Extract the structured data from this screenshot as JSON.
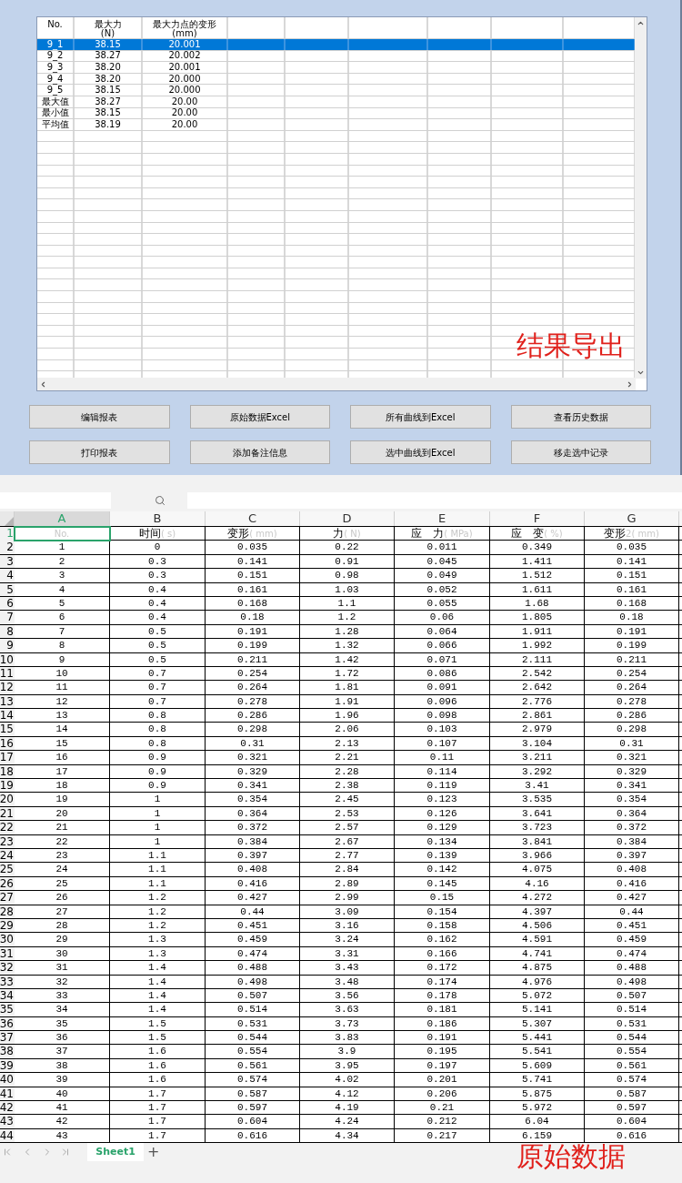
{
  "results_table": {
    "columns": [
      {
        "title": "No."
      },
      {
        "title": "最大力",
        "unit": "(N)"
      },
      {
        "title": "最大力点的变形",
        "unit": "(mm)"
      }
    ],
    "rows": [
      {
        "cells": [
          "9_1",
          "38.15",
          "20.001"
        ],
        "selected": true
      },
      {
        "cells": [
          "9_2",
          "38.27",
          "20.002"
        ],
        "selected": false
      },
      {
        "cells": [
          "9_3",
          "38.20",
          "20.001"
        ],
        "selected": false
      },
      {
        "cells": [
          "9_4",
          "38.20",
          "20.000"
        ],
        "selected": false
      },
      {
        "cells": [
          "9_5",
          "38.15",
          "20.000"
        ],
        "selected": false
      },
      {
        "cells": [
          "最大值",
          "38.27",
          "20.00"
        ],
        "selected": false
      },
      {
        "cells": [
          "最小值",
          "38.15",
          "20.00"
        ],
        "selected": false
      },
      {
        "cells": [
          "平均值",
          "38.19",
          "20.00"
        ],
        "selected": false
      }
    ],
    "overlay_label": "结果导出"
  },
  "buttons": [
    "编辑报表",
    "原始数据Excel",
    "所有曲线到Excel",
    "查看历史数据",
    "打印报表",
    "添加备注信息",
    "选中曲线到Excel",
    "移走选中记录"
  ],
  "sheet": {
    "columns": [
      {
        "letter": "A",
        "selected": true
      },
      {
        "letter": "B",
        "selected": false
      },
      {
        "letter": "C",
        "selected": false
      },
      {
        "letter": "D",
        "selected": false
      },
      {
        "letter": "E",
        "selected": false
      },
      {
        "letter": "F",
        "selected": false
      },
      {
        "letter": "G",
        "selected": false
      }
    ],
    "header_row": [
      {
        "unit": "No.",
        "selected": true
      },
      {
        "label": "时间",
        "unit": "( s)",
        "selected": false
      },
      {
        "label": "变形",
        "unit": "( mm)",
        "selected": false
      },
      {
        "label": "力",
        "unit": "( N)",
        "selected": false
      },
      {
        "label": "应　力",
        "unit": "( MPa)",
        "selected": false
      },
      {
        "label": "应　变",
        "unit": "( %)",
        "selected": false
      },
      {
        "label": "变形",
        "unit": "2( mm)",
        "selected": false
      }
    ],
    "row_headers": [
      {
        "label": "1",
        "selected": true
      },
      {
        "label": "2",
        "selected": false
      },
      {
        "label": "3",
        "selected": false
      },
      {
        "label": "4",
        "selected": false
      },
      {
        "label": "5",
        "selected": false
      },
      {
        "label": "6",
        "selected": false
      },
      {
        "label": "7",
        "selected": false
      },
      {
        "label": "8",
        "selected": false
      },
      {
        "label": "9",
        "selected": false
      },
      {
        "label": "10",
        "selected": false
      },
      {
        "label": "11",
        "selected": false
      },
      {
        "label": "12",
        "selected": false
      },
      {
        "label": "13",
        "selected": false
      },
      {
        "label": "14",
        "selected": false
      },
      {
        "label": "15",
        "selected": false
      },
      {
        "label": "16",
        "selected": false
      },
      {
        "label": "17",
        "selected": false
      },
      {
        "label": "18",
        "selected": false
      },
      {
        "label": "19",
        "selected": false
      },
      {
        "label": "20",
        "selected": false
      },
      {
        "label": "21",
        "selected": false
      },
      {
        "label": "22",
        "selected": false
      },
      {
        "label": "23",
        "selected": false
      },
      {
        "label": "24",
        "selected": false
      },
      {
        "label": "25",
        "selected": false
      },
      {
        "label": "26",
        "selected": false
      },
      {
        "label": "27",
        "selected": false
      },
      {
        "label": "28",
        "selected": false
      },
      {
        "label": "29",
        "selected": false
      },
      {
        "label": "30",
        "selected": false
      },
      {
        "label": "31",
        "selected": false
      },
      {
        "label": "32",
        "selected": false
      },
      {
        "label": "33",
        "selected": false
      },
      {
        "label": "34",
        "selected": false
      },
      {
        "label": "35",
        "selected": false
      },
      {
        "label": "36",
        "selected": false
      },
      {
        "label": "37",
        "selected": false
      },
      {
        "label": "38",
        "selected": false
      },
      {
        "label": "39",
        "selected": false
      },
      {
        "label": "40",
        "selected": false
      },
      {
        "label": "41",
        "selected": false
      },
      {
        "label": "42",
        "selected": false
      },
      {
        "label": "43",
        "selected": false
      },
      {
        "label": "44",
        "selected": false
      }
    ],
    "rows": [
      [
        "1",
        "0",
        "0.035",
        "0.22",
        "0.011",
        "0.349",
        "0.035"
      ],
      [
        "2",
        "0.3",
        "0.141",
        "0.91",
        "0.045",
        "1.411",
        "0.141"
      ],
      [
        "3",
        "0.3",
        "0.151",
        "0.98",
        "0.049",
        "1.512",
        "0.151"
      ],
      [
        "4",
        "0.4",
        "0.161",
        "1.03",
        "0.052",
        "1.611",
        "0.161"
      ],
      [
        "5",
        "0.4",
        "0.168",
        "1.1",
        "0.055",
        "1.68",
        "0.168"
      ],
      [
        "6",
        "0.4",
        "0.18",
        "1.2",
        "0.06",
        "1.805",
        "0.18"
      ],
      [
        "7",
        "0.5",
        "0.191",
        "1.28",
        "0.064",
        "1.911",
        "0.191"
      ],
      [
        "8",
        "0.5",
        "0.199",
        "1.32",
        "0.066",
        "1.992",
        "0.199"
      ],
      [
        "9",
        "0.5",
        "0.211",
        "1.42",
        "0.071",
        "2.111",
        "0.211"
      ],
      [
        "10",
        "0.7",
        "0.254",
        "1.72",
        "0.086",
        "2.542",
        "0.254"
      ],
      [
        "11",
        "0.7",
        "0.264",
        "1.81",
        "0.091",
        "2.642",
        "0.264"
      ],
      [
        "12",
        "0.7",
        "0.278",
        "1.91",
        "0.096",
        "2.776",
        "0.278"
      ],
      [
        "13",
        "0.8",
        "0.286",
        "1.96",
        "0.098",
        "2.861",
        "0.286"
      ],
      [
        "14",
        "0.8",
        "0.298",
        "2.06",
        "0.103",
        "2.979",
        "0.298"
      ],
      [
        "15",
        "0.8",
        "0.31",
        "2.13",
        "0.107",
        "3.104",
        "0.31"
      ],
      [
        "16",
        "0.9",
        "0.321",
        "2.21",
        "0.11",
        "3.211",
        "0.321"
      ],
      [
        "17",
        "0.9",
        "0.329",
        "2.28",
        "0.114",
        "3.292",
        "0.329"
      ],
      [
        "18",
        "0.9",
        "0.341",
        "2.38",
        "0.119",
        "3.41",
        "0.341"
      ],
      [
        "19",
        "1",
        "0.354",
        "2.45",
        "0.123",
        "3.535",
        "0.354"
      ],
      [
        "20",
        "1",
        "0.364",
        "2.53",
        "0.126",
        "3.641",
        "0.364"
      ],
      [
        "21",
        "1",
        "0.372",
        "2.57",
        "0.129",
        "3.723",
        "0.372"
      ],
      [
        "22",
        "1",
        "0.384",
        "2.67",
        "0.134",
        "3.841",
        "0.384"
      ],
      [
        "23",
        "1.1",
        "0.397",
        "2.77",
        "0.139",
        "3.966",
        "0.397"
      ],
      [
        "24",
        "1.1",
        "0.408",
        "2.84",
        "0.142",
        "4.075",
        "0.408"
      ],
      [
        "25",
        "1.1",
        "0.416",
        "2.89",
        "0.145",
        "4.16",
        "0.416"
      ],
      [
        "26",
        "1.2",
        "0.427",
        "2.99",
        "0.15",
        "4.272",
        "0.427"
      ],
      [
        "27",
        "1.2",
        "0.44",
        "3.09",
        "0.154",
        "4.397",
        "0.44"
      ],
      [
        "28",
        "1.2",
        "0.451",
        "3.16",
        "0.158",
        "4.506",
        "0.451"
      ],
      [
        "29",
        "1.3",
        "0.459",
        "3.24",
        "0.162",
        "4.591",
        "0.459"
      ],
      [
        "30",
        "1.3",
        "0.474",
        "3.31",
        "0.166",
        "4.741",
        "0.474"
      ],
      [
        "31",
        "1.4",
        "0.488",
        "3.43",
        "0.172",
        "4.875",
        "0.488"
      ],
      [
        "32",
        "1.4",
        "0.498",
        "3.48",
        "0.174",
        "4.976",
        "0.498"
      ],
      [
        "33",
        "1.4",
        "0.507",
        "3.56",
        "0.178",
        "5.072",
        "0.507"
      ],
      [
        "34",
        "1.4",
        "0.514",
        "3.63",
        "0.181",
        "5.141",
        "0.514"
      ],
      [
        "35",
        "1.5",
        "0.531",
        "3.73",
        "0.186",
        "5.307",
        "0.531"
      ],
      [
        "36",
        "1.5",
        "0.544",
        "3.83",
        "0.191",
        "5.441",
        "0.544"
      ],
      [
        "37",
        "1.6",
        "0.554",
        "3.9",
        "0.195",
        "5.541",
        "0.554"
      ],
      [
        "38",
        "1.6",
        "0.561",
        "3.95",
        "0.197",
        "5.609",
        "0.561"
      ],
      [
        "39",
        "1.6",
        "0.574",
        "4.02",
        "0.201",
        "5.741",
        "0.574"
      ],
      [
        "40",
        "1.7",
        "0.587",
        "4.12",
        "0.206",
        "5.875",
        "0.587"
      ],
      [
        "41",
        "1.7",
        "0.597",
        "4.19",
        "0.21",
        "5.972",
        "0.597"
      ],
      [
        "42",
        "1.7",
        "0.604",
        "4.24",
        "0.212",
        "6.04",
        "0.604"
      ],
      [
        "43",
        "1.7",
        "0.616",
        "4.34",
        "0.217",
        "6.159",
        "0.616"
      ]
    ],
    "tabs": [
      {
        "label": "Sheet1",
        "selected": true
      }
    ],
    "add_tab": "+",
    "overlay_label": "原始数据"
  }
}
